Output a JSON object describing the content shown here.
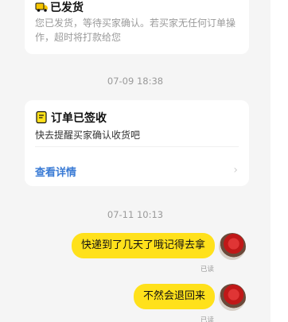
{
  "shipped_card": {
    "icon": "truck-icon",
    "title": "已发货",
    "body": "您已发货，等待买家确认。若买家无任何订单操作，超时将打款给您"
  },
  "timestamp_1": "07-09 18:38",
  "signed_card": {
    "icon": "receipt-icon",
    "title": "订单已签收",
    "body": "快去提醒买家确认收货吧",
    "link": "查看详情",
    "chevron": "›"
  },
  "timestamp_2": "07-11 10:13",
  "messages": [
    {
      "text": "快递到了几天了哦记得去拿",
      "status": "已读"
    },
    {
      "text": "不然会退回来",
      "status": "已读"
    }
  ],
  "colors": {
    "bubble": "#ffe11b",
    "link": "#3a7bd5",
    "background": "#f5f5f5",
    "card": "#ffffff"
  }
}
